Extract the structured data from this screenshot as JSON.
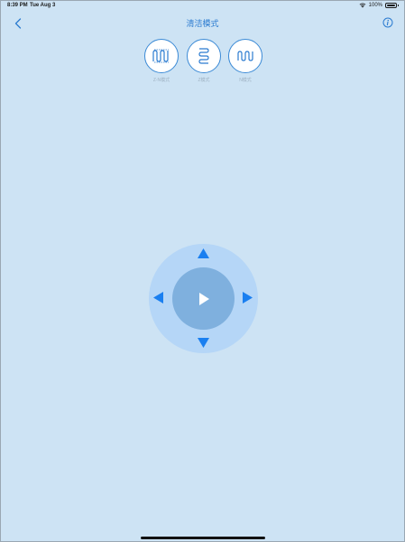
{
  "status_bar": {
    "time": "8:39 PM",
    "date": "Tue Aug 3",
    "battery": "100%"
  },
  "nav": {
    "title": "清洁模式"
  },
  "modes": [
    {
      "label": "Z-N模式",
      "icon": "zigzag-n-icon"
    },
    {
      "label": "Z模式",
      "icon": "zigzag-z-icon"
    },
    {
      "label": "N模式",
      "icon": "zigzag-n-wave-icon"
    }
  ],
  "colors": {
    "background": "#cde3f4",
    "accent": "#2b7bd0",
    "arrow": "#1a7ff0",
    "dpad_outer": "#b5d6f7",
    "dpad_inner": "#7fb0de"
  }
}
